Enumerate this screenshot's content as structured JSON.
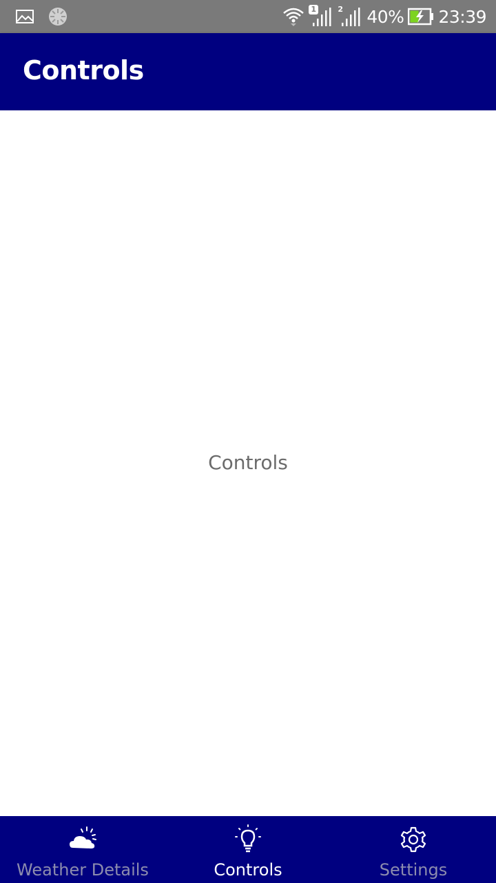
{
  "status_bar": {
    "signal_1_label": "1",
    "signal_2_label": "2",
    "battery_percent": "40%",
    "time": "23:39",
    "battery_accent": "#7dd321"
  },
  "app_bar": {
    "title": "Controls",
    "background": "#000080"
  },
  "content": {
    "label": "Controls"
  },
  "bottom_nav": {
    "active_index": 1,
    "items": [
      {
        "label": "Weather Details",
        "icon": "weather-cloud-sun-icon"
      },
      {
        "label": "Controls",
        "icon": "lightbulb-icon"
      },
      {
        "label": "Settings",
        "icon": "gear-icon"
      }
    ]
  }
}
